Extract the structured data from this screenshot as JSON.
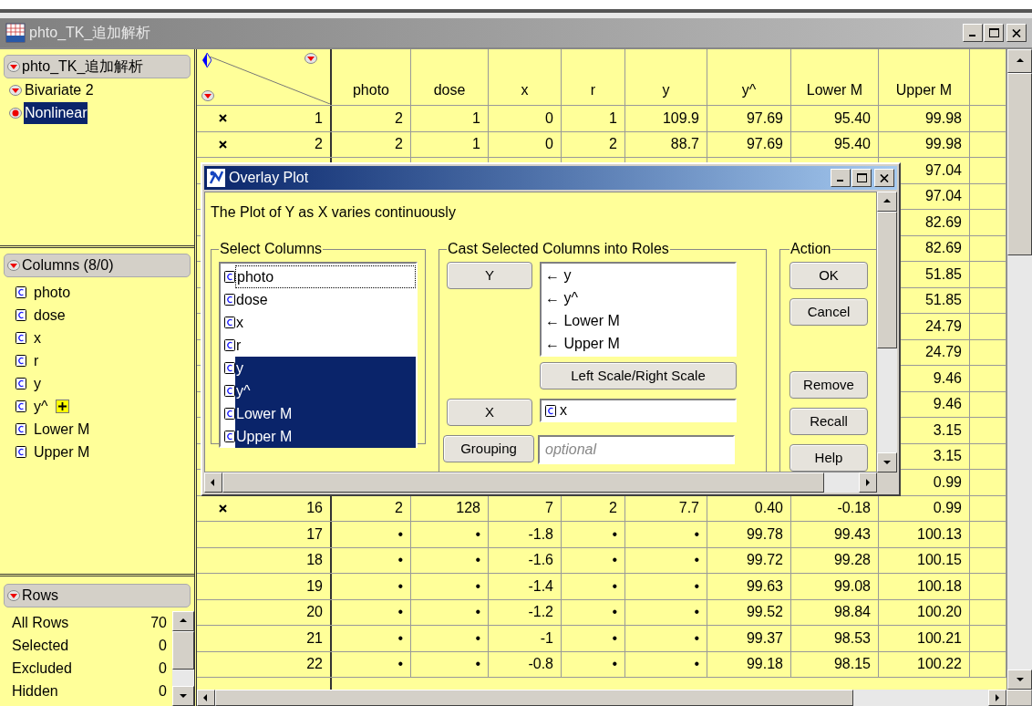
{
  "window": {
    "title": "phto_TK_追加解析"
  },
  "left_panel": {
    "table_header": "phto_TK_追加解析",
    "scripts": [
      {
        "label": "Bivariate 2",
        "kind": "script",
        "selected": false
      },
      {
        "label": "Nonlinear",
        "kind": "nonlinear",
        "selected": true
      }
    ],
    "columns_header": "Columns (8/0)",
    "columns": [
      {
        "name": "photo",
        "formula": false
      },
      {
        "name": "dose",
        "formula": false
      },
      {
        "name": "x",
        "formula": false
      },
      {
        "name": "r",
        "formula": false
      },
      {
        "name": "y",
        "formula": false
      },
      {
        "name": "y^",
        "formula": true
      },
      {
        "name": "Lower M",
        "formula": false
      },
      {
        "name": "Upper M",
        "formula": false
      }
    ],
    "rows_header": "Rows",
    "row_stats": [
      {
        "label": "All Rows",
        "value": "70"
      },
      {
        "label": "Selected",
        "value": "0"
      },
      {
        "label": "Excluded",
        "value": "0"
      },
      {
        "label": "Hidden",
        "value": "0"
      }
    ]
  },
  "table": {
    "columns": [
      "photo",
      "dose",
      "x",
      "r",
      "y",
      "y^",
      "Lower M",
      "Upper M"
    ],
    "rows": [
      {
        "label": "1",
        "marked": true,
        "cells": [
          "2",
          "1",
          "0",
          "1",
          "109.9",
          "97.69",
          "95.40",
          "99.98"
        ]
      },
      {
        "label": "2",
        "marked": true,
        "cells": [
          "2",
          "1",
          "0",
          "2",
          "88.7",
          "97.69",
          "95.40",
          "99.98"
        ]
      },
      {
        "cells": [
          "97.04"
        ]
      },
      {
        "cells": [
          "97.04"
        ]
      },
      {
        "cells": [
          "82.69"
        ]
      },
      {
        "cells": [
          "82.69"
        ]
      },
      {
        "cells": [
          "51.85"
        ]
      },
      {
        "cells": [
          "51.85"
        ]
      },
      {
        "cells": [
          "24.79"
        ]
      },
      {
        "cells": [
          "24.79"
        ]
      },
      {
        "cells": [
          "9.46"
        ]
      },
      {
        "cells": [
          "9.46"
        ]
      },
      {
        "cells": [
          "3.15"
        ]
      },
      {
        "cells": [
          "3.15"
        ]
      },
      {
        "cells": [
          "0.99"
        ]
      },
      {
        "label": "16",
        "marked": true,
        "cells": [
          "2",
          "128",
          "7",
          "2",
          "7.7",
          "0.40",
          "-0.18",
          "0.99"
        ]
      },
      {
        "label": "17",
        "marked": false,
        "cells": [
          "•",
          "•",
          "-1.8",
          "•",
          "•",
          "99.78",
          "99.43",
          "100.13"
        ]
      },
      {
        "label": "18",
        "marked": false,
        "cells": [
          "•",
          "•",
          "-1.6",
          "•",
          "•",
          "99.72",
          "99.28",
          "100.15"
        ]
      },
      {
        "label": "19",
        "marked": false,
        "cells": [
          "•",
          "•",
          "-1.4",
          "•",
          "•",
          "99.63",
          "99.08",
          "100.18"
        ]
      },
      {
        "label": "20",
        "marked": false,
        "cells": [
          "•",
          "•",
          "-1.2",
          "•",
          "•",
          "99.52",
          "98.84",
          "100.20"
        ]
      },
      {
        "label": "21",
        "marked": false,
        "cells": [
          "•",
          "•",
          "-1",
          "•",
          "•",
          "99.37",
          "98.53",
          "100.21"
        ]
      },
      {
        "label": "22",
        "marked": false,
        "cells": [
          "•",
          "•",
          "-0.8",
          "•",
          "•",
          "99.18",
          "98.15",
          "100.22"
        ]
      }
    ]
  },
  "dialog": {
    "title": "Overlay Plot",
    "description": "The Plot of Y as X varies continuously",
    "select_columns": {
      "title": "Select Columns",
      "items": [
        {
          "name": "photo",
          "selected": false,
          "focused": true
        },
        {
          "name": "dose",
          "selected": false,
          "focused": false
        },
        {
          "name": "x",
          "selected": false,
          "focused": false
        },
        {
          "name": "r",
          "selected": false,
          "focused": false
        },
        {
          "name": "y",
          "selected": true,
          "focused": false
        },
        {
          "name": "y^",
          "selected": true,
          "focused": false
        },
        {
          "name": "Lower M",
          "selected": true,
          "focused": false
        },
        {
          "name": "Upper M",
          "selected": true,
          "focused": false
        }
      ]
    },
    "cast": {
      "title": "Cast Selected Columns into Roles",
      "roles": [
        {
          "kind": "list",
          "button": "Y",
          "values": [
            "← y",
            "← y^",
            "← Lower M",
            "← Upper M"
          ],
          "extra_button": "Left Scale/Right Scale"
        },
        {
          "kind": "column",
          "button": "X",
          "value": "x"
        },
        {
          "kind": "placeholder",
          "button": "Grouping",
          "placeholder": "optional"
        }
      ]
    },
    "action": {
      "title": "Action",
      "button_groups": [
        [
          "OK",
          "Cancel"
        ],
        [
          "Remove",
          "Recall",
          "Help"
        ]
      ]
    }
  }
}
